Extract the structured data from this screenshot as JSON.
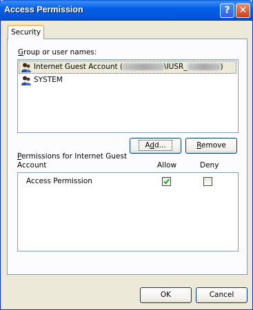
{
  "window": {
    "title": "Access Permission",
    "help_glyph": "?",
    "close_glyph": "✕"
  },
  "tabs": [
    {
      "label": "Security"
    }
  ],
  "group": {
    "label_accel": "G",
    "label_rest": "roup or user names:",
    "users": [
      {
        "name_prefix": "Internet Guest Account (",
        "name_mid": "\\IUSR_",
        "name_suffix": ")"
      },
      {
        "name": "SYSTEM"
      }
    ]
  },
  "buttons": {
    "add": {
      "accel": "d",
      "before": "A",
      "after": "d..."
    },
    "remove": {
      "accel": "R",
      "after": "emove"
    },
    "ok": "OK",
    "cancel": "Cancel"
  },
  "permissions": {
    "label_accel": "P",
    "label_line1_rest": "ermissions for Internet Guest",
    "label_line2": "Account",
    "col_allow": "Allow",
    "col_deny": "Deny",
    "rows": [
      {
        "name": "Access Permission",
        "allow": true,
        "deny": false
      }
    ]
  },
  "colors": {
    "titlebar": "#0558e0",
    "dialog_bg": "#ece9d8",
    "border": "#7f9db9",
    "check": "#21a121"
  }
}
